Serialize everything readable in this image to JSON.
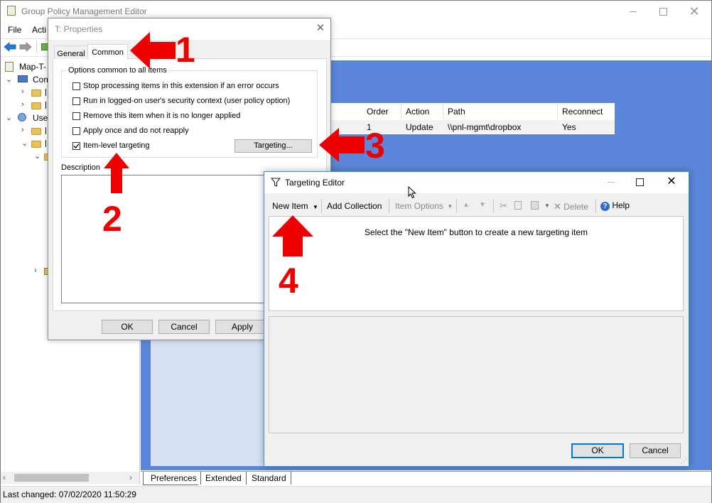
{
  "main_window": {
    "title": "Group Policy Management Editor",
    "menu": [
      "File",
      "Acti"
    ],
    "tree": {
      "root": "Map-T-",
      "computer": "Com",
      "user": "User"
    },
    "table": {
      "columns": [
        "Order",
        "Action",
        "Path",
        "Reconnect"
      ],
      "rows": [
        {
          "order": "1",
          "action": "Update",
          "path": "\\\\pnl-mgmt\\dropbox",
          "reconnect": "Yes"
        }
      ]
    },
    "tabs": [
      "Preferences",
      "Extended",
      "Standard"
    ],
    "status": "Last changed: 07/02/2020 11:50:29"
  },
  "properties": {
    "title": "T: Properties",
    "tabs": [
      "General",
      "Common"
    ],
    "group_label": "Options common to all items",
    "options": [
      {
        "label": "Stop processing items in this extension if an error occurs",
        "checked": false
      },
      {
        "label": "Run in logged-on user's security context (user policy option)",
        "checked": false
      },
      {
        "label": "Remove this item when it is no longer applied",
        "checked": false
      },
      {
        "label": "Apply once and do not reapply",
        "checked": false
      },
      {
        "label": "Item-level targeting",
        "checked": true
      }
    ],
    "targeting_button": "Targeting...",
    "description_label": "Description",
    "buttons": {
      "ok": "OK",
      "cancel": "Cancel",
      "apply": "Apply"
    }
  },
  "targeting_editor": {
    "title": "Targeting Editor",
    "toolbar": {
      "new_item": "New Item",
      "add_collection": "Add Collection",
      "item_options": "Item Options",
      "delete": "Delete",
      "help": "Help"
    },
    "hint": "Select the \"New Item\" button to create a new targeting item",
    "buttons": {
      "ok": "OK",
      "cancel": "Cancel"
    }
  },
  "annotations": [
    "1",
    "2",
    "3",
    "4"
  ],
  "colors": {
    "annotation_red": "#ee0000",
    "background_blue": "#5b86d9",
    "pane_light": "#d6e1f5",
    "focus_blue": "#0078d7"
  }
}
